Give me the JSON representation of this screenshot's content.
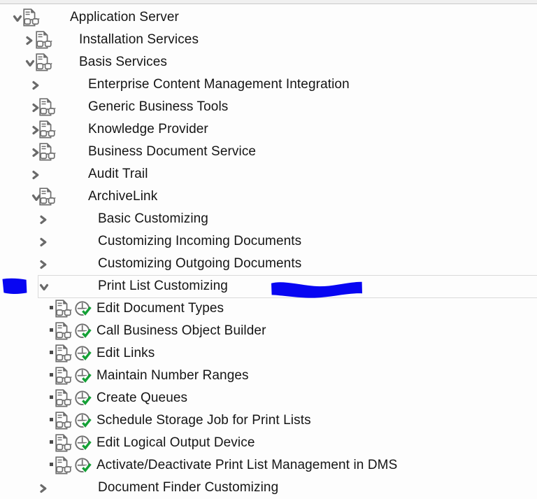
{
  "window": {
    "kind": "sap-img-customizing-tree",
    "top_strip_color": "#f0f0f0",
    "background": "#fdfdfd"
  },
  "colors": {
    "icon_gray": "#6e6e6e",
    "arrow_gray": "#6a6a6a",
    "check_green": "#13a035",
    "text": "#151515",
    "annotation_blue": "#0806f2",
    "focus_outline": "#dadada",
    "bullet_gray": "#4c4c4c"
  },
  "icons": {
    "collapsed": "chevron-right-icon",
    "expanded": "chevron-down-icon",
    "node_doc": "document-glasses-icon",
    "activity": "execute-activity-check-icon",
    "leaf_marker": "square-bullet-icon"
  },
  "tree": {
    "rows": [
      {
        "label": "Application Server",
        "level": 0,
        "expanded": true,
        "doc_icon": true,
        "leaf": false
      },
      {
        "label": "Installation Services",
        "level": 1,
        "expanded": false,
        "doc_icon": true,
        "leaf": false
      },
      {
        "label": "Basis Services",
        "level": 1,
        "expanded": true,
        "doc_icon": true,
        "leaf": false
      },
      {
        "label": "Enterprise Content Management Integration",
        "level": 2,
        "expanded": false,
        "doc_icon": false,
        "leaf": false
      },
      {
        "label": "Generic Business Tools",
        "level": 2,
        "expanded": false,
        "doc_icon": true,
        "leaf": false
      },
      {
        "label": "Knowledge Provider",
        "level": 2,
        "expanded": false,
        "doc_icon": true,
        "leaf": false
      },
      {
        "label": "Business Document Service",
        "level": 2,
        "expanded": false,
        "doc_icon": true,
        "leaf": false
      },
      {
        "label": "Audit Trail",
        "level": 2,
        "expanded": false,
        "doc_icon": false,
        "leaf": false
      },
      {
        "label": "ArchiveLink",
        "level": 2,
        "expanded": true,
        "doc_icon": true,
        "leaf": false
      },
      {
        "label": "Basic Customizing",
        "level": 3,
        "expanded": false,
        "doc_icon": false,
        "leaf": false
      },
      {
        "label": "Customizing Incoming Documents",
        "level": 3,
        "expanded": false,
        "doc_icon": false,
        "leaf": false
      },
      {
        "label": "Customizing Outgoing Documents",
        "level": 3,
        "expanded": false,
        "doc_icon": false,
        "leaf": false
      },
      {
        "label": "Print List Customizing",
        "level": 3,
        "expanded": true,
        "doc_icon": false,
        "leaf": false,
        "focused": true
      },
      {
        "label": "Edit Document Types",
        "level": 4,
        "leaf": true
      },
      {
        "label": "Call Business Object Builder",
        "level": 4,
        "leaf": true
      },
      {
        "label": "Edit Links",
        "level": 4,
        "leaf": true
      },
      {
        "label": "Maintain Number Ranges",
        "level": 4,
        "leaf": true
      },
      {
        "label": "Create Queues",
        "level": 4,
        "leaf": true
      },
      {
        "label": "Schedule Storage Job for Print Lists",
        "level": 4,
        "leaf": true
      },
      {
        "label": "Edit Logical Output Device",
        "level": 4,
        "leaf": true
      },
      {
        "label": "Activate/Deactivate Print List Management in DMS",
        "level": 4,
        "leaf": true
      },
      {
        "label": "Document Finder Customizing",
        "level": 3,
        "expanded": false,
        "doc_icon": false,
        "leaf": false,
        "clipped": true
      }
    ]
  },
  "annotations": {
    "left_scribble": "blue-marker-annotation-left",
    "right_scribble": "blue-marker-annotation-right"
  }
}
